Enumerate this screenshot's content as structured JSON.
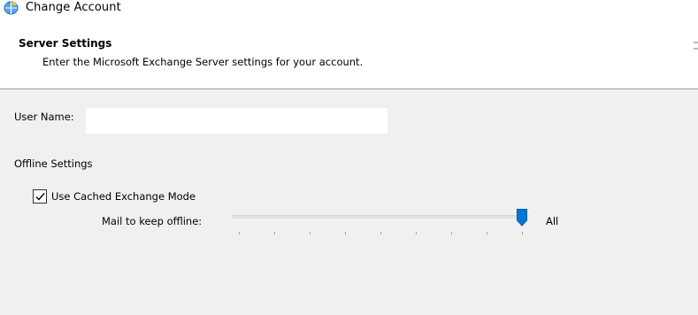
{
  "window": {
    "title": "Change Account",
    "icon": "outlook-profile-icon"
  },
  "header": {
    "title": "Server Settings",
    "subtitle": "Enter the Microsoft Exchange Server settings for your account."
  },
  "form": {
    "user_name_label": "User Name:",
    "user_name_value": "",
    "offline_settings_heading": "Offline Settings",
    "cached_mode_label": "Use Cached Exchange Mode",
    "cached_mode_checked": true,
    "mail_offline_label": "Mail to keep offline:",
    "mail_offline_value": "All",
    "mail_offline_slider_level": 1.0,
    "mail_offline_tick_count": 9
  },
  "colors": {
    "accent": "#0078d7",
    "body_bg": "#f0f0f0",
    "header_bg": "#ffffff"
  }
}
